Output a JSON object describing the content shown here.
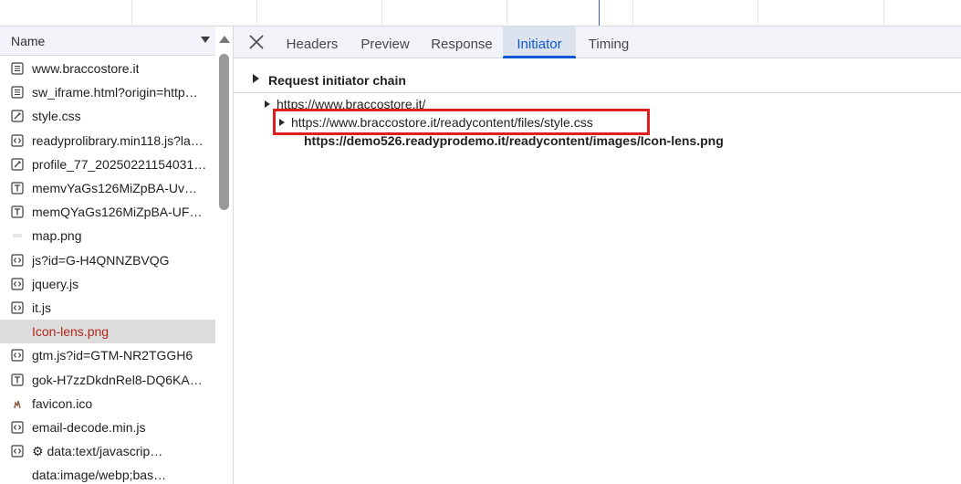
{
  "list": {
    "header_label": "Name",
    "items": [
      {
        "label": "www.braccostore.it",
        "icon": "document-icon"
      },
      {
        "label": "sw_iframe.html?origin=http…",
        "icon": "document-icon"
      },
      {
        "label": "style.css",
        "icon": "stylesheet-icon"
      },
      {
        "label": "readyprolibrary.min118.js?la…",
        "icon": "script-icon"
      },
      {
        "label": "profile_77_20250221154031…",
        "icon": "stylesheet-icon"
      },
      {
        "label": "memvYaGs126MiZpBA-Uv…",
        "icon": "font-icon"
      },
      {
        "label": "memQYaGs126MiZpBA-UF…",
        "icon": "font-icon"
      },
      {
        "label": "map.png",
        "icon": "image-icon"
      },
      {
        "label": "js?id=G-H4QNNZBVQG",
        "icon": "script-icon"
      },
      {
        "label": "jquery.js",
        "icon": "script-icon"
      },
      {
        "label": "it.js",
        "icon": "script-icon"
      },
      {
        "label": "Icon-lens.png",
        "icon": "none"
      },
      {
        "label": "gtm.js?id=GTM-NR2TGGH6",
        "icon": "script-icon"
      },
      {
        "label": "gok-H7zzDkdnRel8-DQ6KA…",
        "icon": "font-icon"
      },
      {
        "label": "favicon.ico",
        "icon": "favicon-icon"
      },
      {
        "label": "email-decode.min.js",
        "icon": "script-icon"
      },
      {
        "label": "⚙ data:text/javascrip…",
        "icon": "script-icon"
      },
      {
        "label": "data:image/webp;bas…",
        "icon": "none"
      }
    ],
    "selected_index": 11
  },
  "tabs": {
    "items": [
      "Headers",
      "Preview",
      "Response",
      "Initiator",
      "Timing"
    ],
    "active": "Initiator"
  },
  "initiator": {
    "section_title": "Request initiator chain",
    "chain": [
      "https://www.braccostore.it/",
      "https://www.braccostore.it/readycontent/files/style.css",
      "https://demo526.readyprodemo.it/readycontent/images/Icon-lens.png"
    ]
  },
  "colors": {
    "accent": "#0b57d0",
    "highlight_border": "#e01e1e",
    "selected_row": "#dcdcdc",
    "selected_text": "#b3261e"
  }
}
